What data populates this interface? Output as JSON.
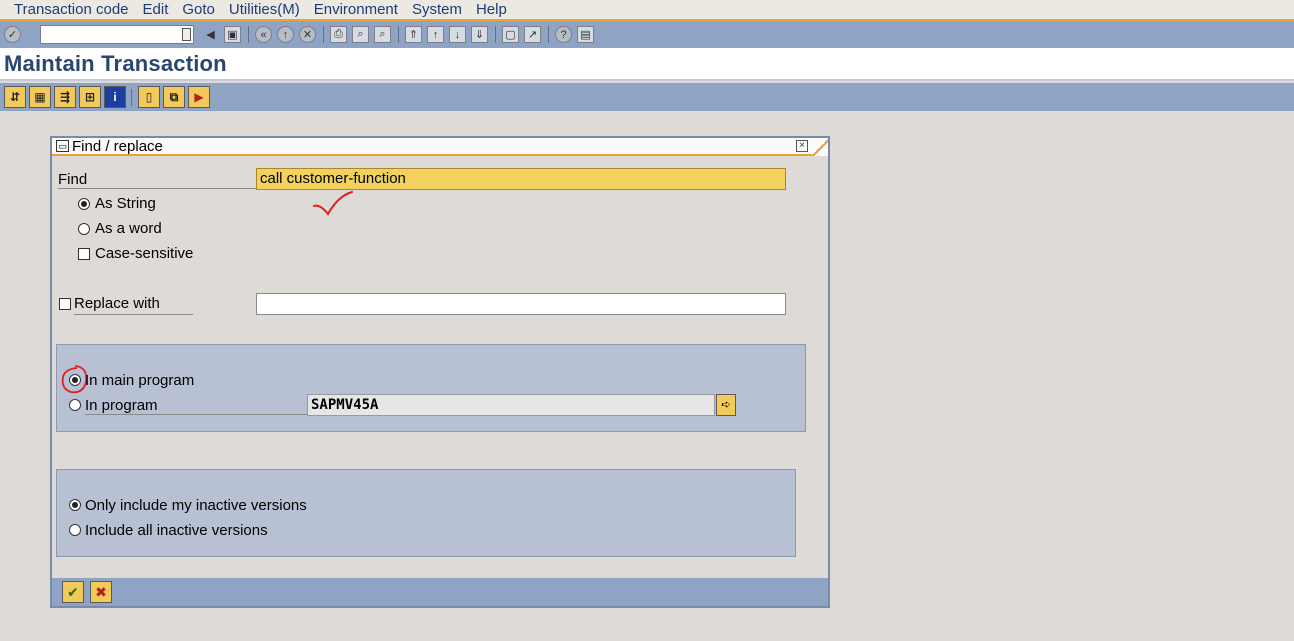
{
  "menu": [
    "Transaction code",
    "Edit",
    "Goto",
    "Utilities(M)",
    "Environment",
    "System",
    "Help"
  ],
  "page_title": "Maintain Transaction",
  "dialog": {
    "title": "Find / replace",
    "find_label": "Find",
    "find_value": "call customer-function",
    "as_string": "As String",
    "as_word": "As a word",
    "case_sensitive": "Case-sensitive",
    "replace_label": "Replace with",
    "replace_value": "",
    "in_main_program": "In main program",
    "in_program": "In program",
    "program_value": "SAPMV45A",
    "only_my_inactive": "Only include my inactive versions",
    "all_inactive": "Include all inactive versions"
  },
  "colors": {
    "toolbar": "#8fa3c4",
    "title": "#2a4670",
    "highlight_field": "#f2d25c",
    "annotation": "#e02020"
  }
}
